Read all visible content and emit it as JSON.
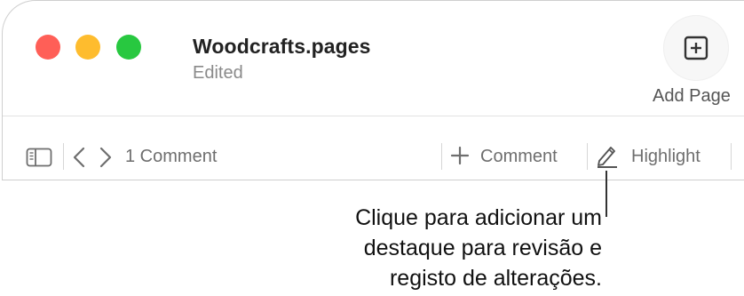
{
  "window": {
    "title": "Woodcrafts.pages",
    "status": "Edited"
  },
  "toolbar": {
    "add_page_label": "Add Page",
    "comment_count": "1 Comment",
    "comment_label": "Comment",
    "highlight_label": "Highlight"
  },
  "callout": {
    "lines": [
      "Clique para adicionar um",
      "destaque para revisão e",
      "registo de alterações."
    ]
  },
  "colors": {
    "close": "#ff5f57",
    "minimize": "#febc2e",
    "zoom": "#28c840"
  },
  "icons": [
    "sidebar-icon",
    "chevron-left-icon",
    "chevron-right-icon",
    "plus-icon",
    "pencil-icon",
    "add-page-icon"
  ]
}
